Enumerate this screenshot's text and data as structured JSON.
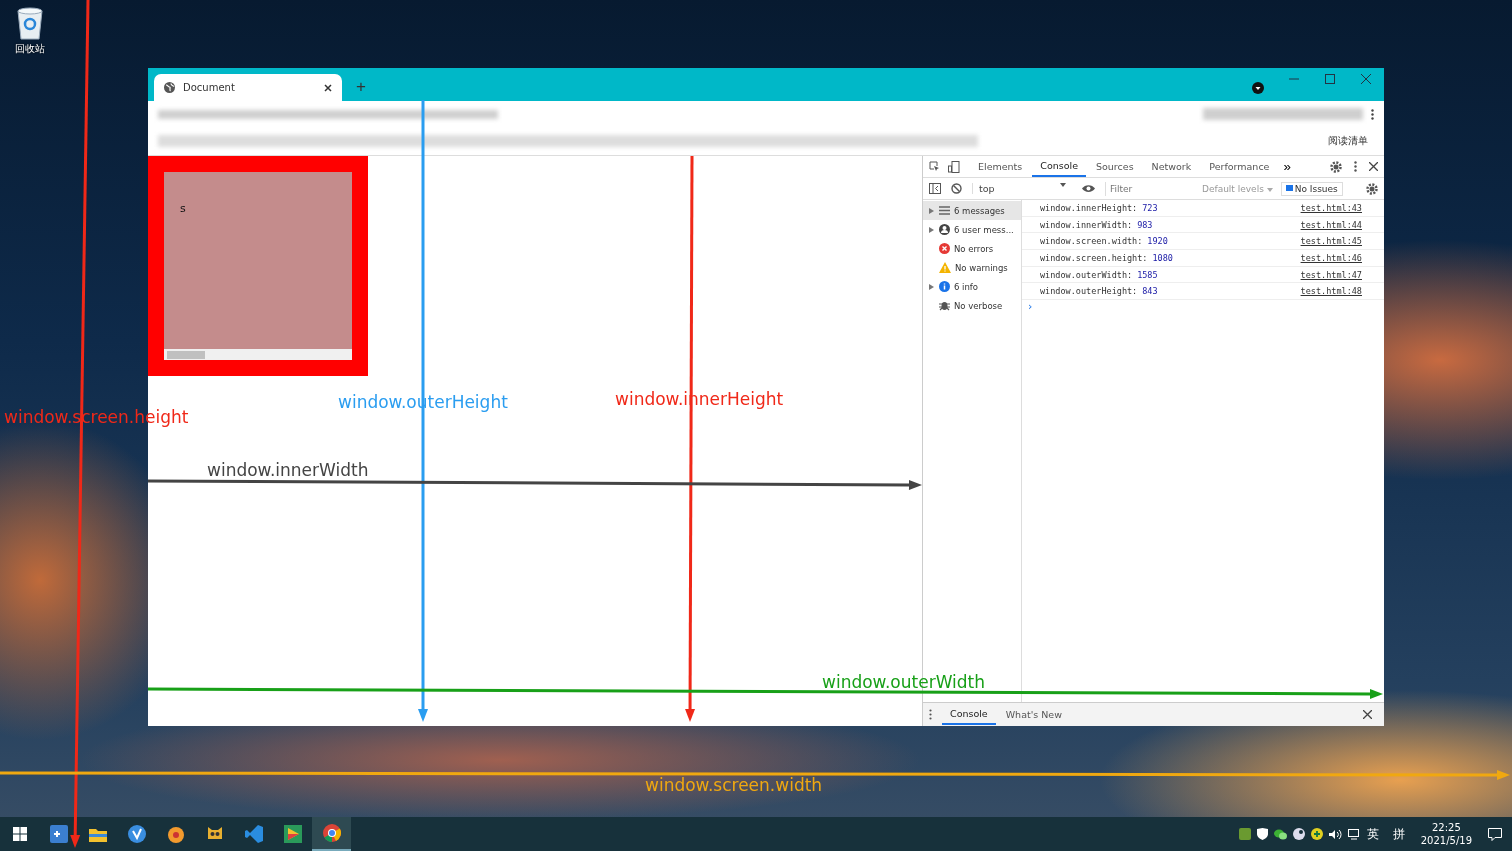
{
  "desktop": {
    "icons": [
      {
        "label": "回收站"
      }
    ]
  },
  "browser": {
    "tabs": [
      {
        "title": "Document",
        "selected": true
      }
    ],
    "new_tab": "+",
    "reading_list": "阅读清单"
  },
  "page": {
    "box_text": "s"
  },
  "devtools": {
    "tabs": [
      {
        "label": "Elements",
        "selected": false
      },
      {
        "label": "Console",
        "selected": true
      },
      {
        "label": "Sources",
        "selected": false
      },
      {
        "label": "Network",
        "selected": false
      },
      {
        "label": "Performance",
        "selected": false
      }
    ],
    "more": "»",
    "context": "top",
    "filter_placeholder": "Filter",
    "levels": "Default levels",
    "issues": "No Issues",
    "sidebar": [
      {
        "kind": "messages",
        "label": "6 messages",
        "expandable": true,
        "selected": true
      },
      {
        "kind": "user",
        "label": "6 user mess...",
        "expandable": true,
        "selected": false
      },
      {
        "kind": "errors",
        "label": "No errors",
        "expandable": false,
        "selected": false
      },
      {
        "kind": "warnings",
        "label": "No warnings",
        "expandable": false,
        "selected": false
      },
      {
        "kind": "info",
        "label": "6 info",
        "expandable": true,
        "selected": false
      },
      {
        "kind": "verbose",
        "label": "No verbose",
        "expandable": false,
        "selected": false
      }
    ],
    "messages": [
      {
        "text": "window.innerHeight:",
        "value": "723",
        "source": "test.html:43"
      },
      {
        "text": "window.innerWidth:",
        "value": "983",
        "source": "test.html:44"
      },
      {
        "text": "window.screen.width:",
        "value": "1920",
        "source": "test.html:45"
      },
      {
        "text": "window.screen.height:",
        "value": "1080",
        "source": "test.html:46"
      },
      {
        "text": "window.outerWidth:",
        "value": "1585",
        "source": "test.html:47"
      },
      {
        "text": "window.outerHeight:",
        "value": "843",
        "source": "test.html:48"
      }
    ],
    "prompt": "›",
    "drawer_tabs": [
      {
        "label": "Console",
        "selected": true
      },
      {
        "label": "What's New",
        "selected": false
      }
    ]
  },
  "annotations": [
    {
      "label": "window.screen.height",
      "color": "#f02818"
    },
    {
      "label": "window.outerHeight",
      "color": "#2a9df0"
    },
    {
      "label": "window.innerHeight",
      "color": "#f02818"
    },
    {
      "label": "window.innerWidth",
      "color": "#444444"
    },
    {
      "label": "window.outerWidth",
      "color": "#18a018"
    },
    {
      "label": "window.screen.width",
      "color": "#f0a810"
    }
  ],
  "taskbar": {
    "ime": "英",
    "ime_mode": "拼",
    "time": "22:25",
    "date": "2021/5/19"
  }
}
